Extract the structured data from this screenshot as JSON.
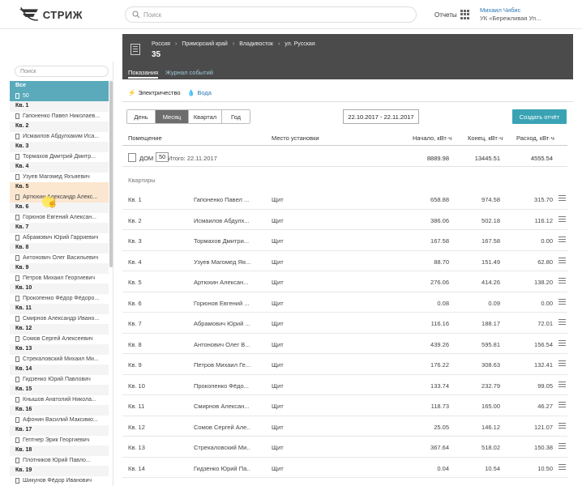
{
  "app": {
    "logo_text": "СТРИЖ"
  },
  "topbar": {
    "search_placeholder": "Поиск",
    "reports_label": "Отчеты",
    "user_name": "Михаил Чибис",
    "user_org": "УК «Бережливая Уп..."
  },
  "sidebar": {
    "search_placeholder": "Поиск",
    "groups": [
      {
        "title": "Все",
        "items": [
          "50"
        ],
        "selected": true
      },
      {
        "title": "Кв. 1",
        "items": [
          "Гапоненко Павел Николаев..."
        ]
      },
      {
        "title": "Кв. 2",
        "items": [
          "Исмаилов Абдулхаким Иса..."
        ]
      },
      {
        "title": "Кв. 3",
        "items": [
          "Тормахов Дмитрий Дмитр..."
        ]
      },
      {
        "title": "Кв. 4",
        "items": [
          "Узуев Магомед Яхъяевич"
        ]
      },
      {
        "title": "Кв. 5",
        "items": [
          "Артюхин Александр Алекс..."
        ],
        "highlighted": true
      },
      {
        "title": "Кв. 6",
        "items": [
          "Горюнов Евгений Алексан..."
        ]
      },
      {
        "title": "Кв. 7",
        "items": [
          "Абрамович Юрий Гарриевич"
        ]
      },
      {
        "title": "Кв. 8",
        "items": [
          "Антонович Олег Васильевич"
        ]
      },
      {
        "title": "Кв. 9",
        "items": [
          "Петров Михаил Георгиевич"
        ]
      },
      {
        "title": "Кв. 10",
        "items": [
          "Прокопенко Фёдор Фёдоро..."
        ]
      },
      {
        "title": "Кв. 11",
        "items": [
          "Смирнов Александр Ивано..."
        ]
      },
      {
        "title": "Кв. 12",
        "items": [
          "Сомов Сергей Алексеевич"
        ]
      },
      {
        "title": "Кв. 13",
        "items": [
          "Стрекаловский Михаил Ми..."
        ]
      },
      {
        "title": "Кв. 14",
        "items": [
          "Гидзенко Юрий Павлович"
        ]
      },
      {
        "title": "Кв. 15",
        "items": [
          "Кнышов Анатолий Никола..."
        ]
      },
      {
        "title": "Кв. 16",
        "items": [
          "Афонин Василий Максимо..."
        ]
      },
      {
        "title": "Кв. 17",
        "items": [
          "Гептнер Эрик Георгиевич"
        ]
      },
      {
        "title": "Кв. 18",
        "items": [
          "Плотников Юрий Павло..."
        ]
      },
      {
        "title": "Кв. 19",
        "items": [
          "Шикунов Фёдор Иванович"
        ]
      }
    ]
  },
  "header": {
    "breadcrumb": [
      "Россия",
      "Приморский край",
      "Владивосток",
      "ул. Русская"
    ],
    "title": "35",
    "tabs": [
      {
        "label": "Показания",
        "active": true
      },
      {
        "label": "Журнал событий",
        "active": false
      }
    ]
  },
  "resource_tabs": [
    {
      "label": "Электричество",
      "icon": "lightning-icon",
      "active": true
    },
    {
      "label": "Вода",
      "icon": "water-drop-icon",
      "active": false
    }
  ],
  "periods": [
    {
      "label": "День",
      "active": false
    },
    {
      "label": "Месяц",
      "active": true
    },
    {
      "label": "Квартал",
      "active": false
    },
    {
      "label": "Год",
      "active": false
    }
  ],
  "date_range": "22.10.2017 - 22.11.2017",
  "create_report_label": "Создать отчёт",
  "table": {
    "headers": {
      "room": "Помещение",
      "location": "Место установки",
      "start": "Начало, кВт·ч",
      "end": "Конец, кВт·ч",
      "usage": "Расход, кВт·ч"
    },
    "house": {
      "label": "ДОМ",
      "count": "50",
      "total": "Итого: 22.11.2017",
      "start": "8889.98",
      "end": "13445.51",
      "usage": "4555.54"
    },
    "section_label": "Квартиры",
    "rows": [
      {
        "apt": "Кв. 1",
        "owner": "Гапоненко Павел ...",
        "place": "Щит",
        "start": "658.88",
        "end": "974.58",
        "usage": "315.70"
      },
      {
        "apt": "Кв. 2",
        "owner": "Исмаилов Абдулх...",
        "place": "Щит",
        "start": "386.06",
        "end": "502.18",
        "usage": "116.12"
      },
      {
        "apt": "Кв. 3",
        "owner": "Тормахов Дмитри...",
        "place": "Щит",
        "start": "167.58",
        "end": "167.58",
        "usage": "0.00"
      },
      {
        "apt": "Кв. 4",
        "owner": "Узуев Магомед Яя...",
        "place": "Щит",
        "start": "88.70",
        "end": "151.49",
        "usage": "62.80"
      },
      {
        "apt": "Кв. 5",
        "owner": "Артюхин Алексан...",
        "place": "Щит",
        "start": "276.06",
        "end": "414.26",
        "usage": "138.20"
      },
      {
        "apt": "Кв. 6",
        "owner": "Горюнов Евгений ...",
        "place": "Щит",
        "start": "0.08",
        "end": "0.09",
        "usage": "0.00"
      },
      {
        "apt": "Кв. 7",
        "owner": "Абрамович Юрий ...",
        "place": "Щит",
        "start": "116.16",
        "end": "188.17",
        "usage": "72.01"
      },
      {
        "apt": "Кв. 8",
        "owner": "Антонович Олег В...",
        "place": "Щит",
        "start": "439.26",
        "end": "595.81",
        "usage": "156.54"
      },
      {
        "apt": "Кв. 9",
        "owner": "Петров Михаил Ге...",
        "place": "Щит",
        "start": "176.22",
        "end": "308.63",
        "usage": "132.41"
      },
      {
        "apt": "Кв. 10",
        "owner": "Прокопенко Фёдо...",
        "place": "Щит",
        "start": "133.74",
        "end": "232.79",
        "usage": "99.05"
      },
      {
        "apt": "Кв. 11",
        "owner": "Смирнов Алексан...",
        "place": "Щит",
        "start": "118.73",
        "end": "165.00",
        "usage": "46.27"
      },
      {
        "apt": "Кв. 12",
        "owner": "Сомов Сергей Але...",
        "place": "Щит",
        "start": "25.05",
        "end": "146.12",
        "usage": "121.07"
      },
      {
        "apt": "Кв. 13",
        "owner": "Стрекаловский Ми...",
        "place": "Щит",
        "start": "367.64",
        "end": "518.02",
        "usage": "150.38"
      },
      {
        "apt": "Кв. 14",
        "owner": "Гидзенко Юрий Па...",
        "place": "Щит",
        "start": "0.04",
        "end": "10.54",
        "usage": "10.50"
      }
    ]
  },
  "colors": {
    "accent": "#39a3b4",
    "sidebar_selected": "#5aaabc",
    "header_bg": "#4b4b4b",
    "highlight": "#fbe6cf"
  }
}
